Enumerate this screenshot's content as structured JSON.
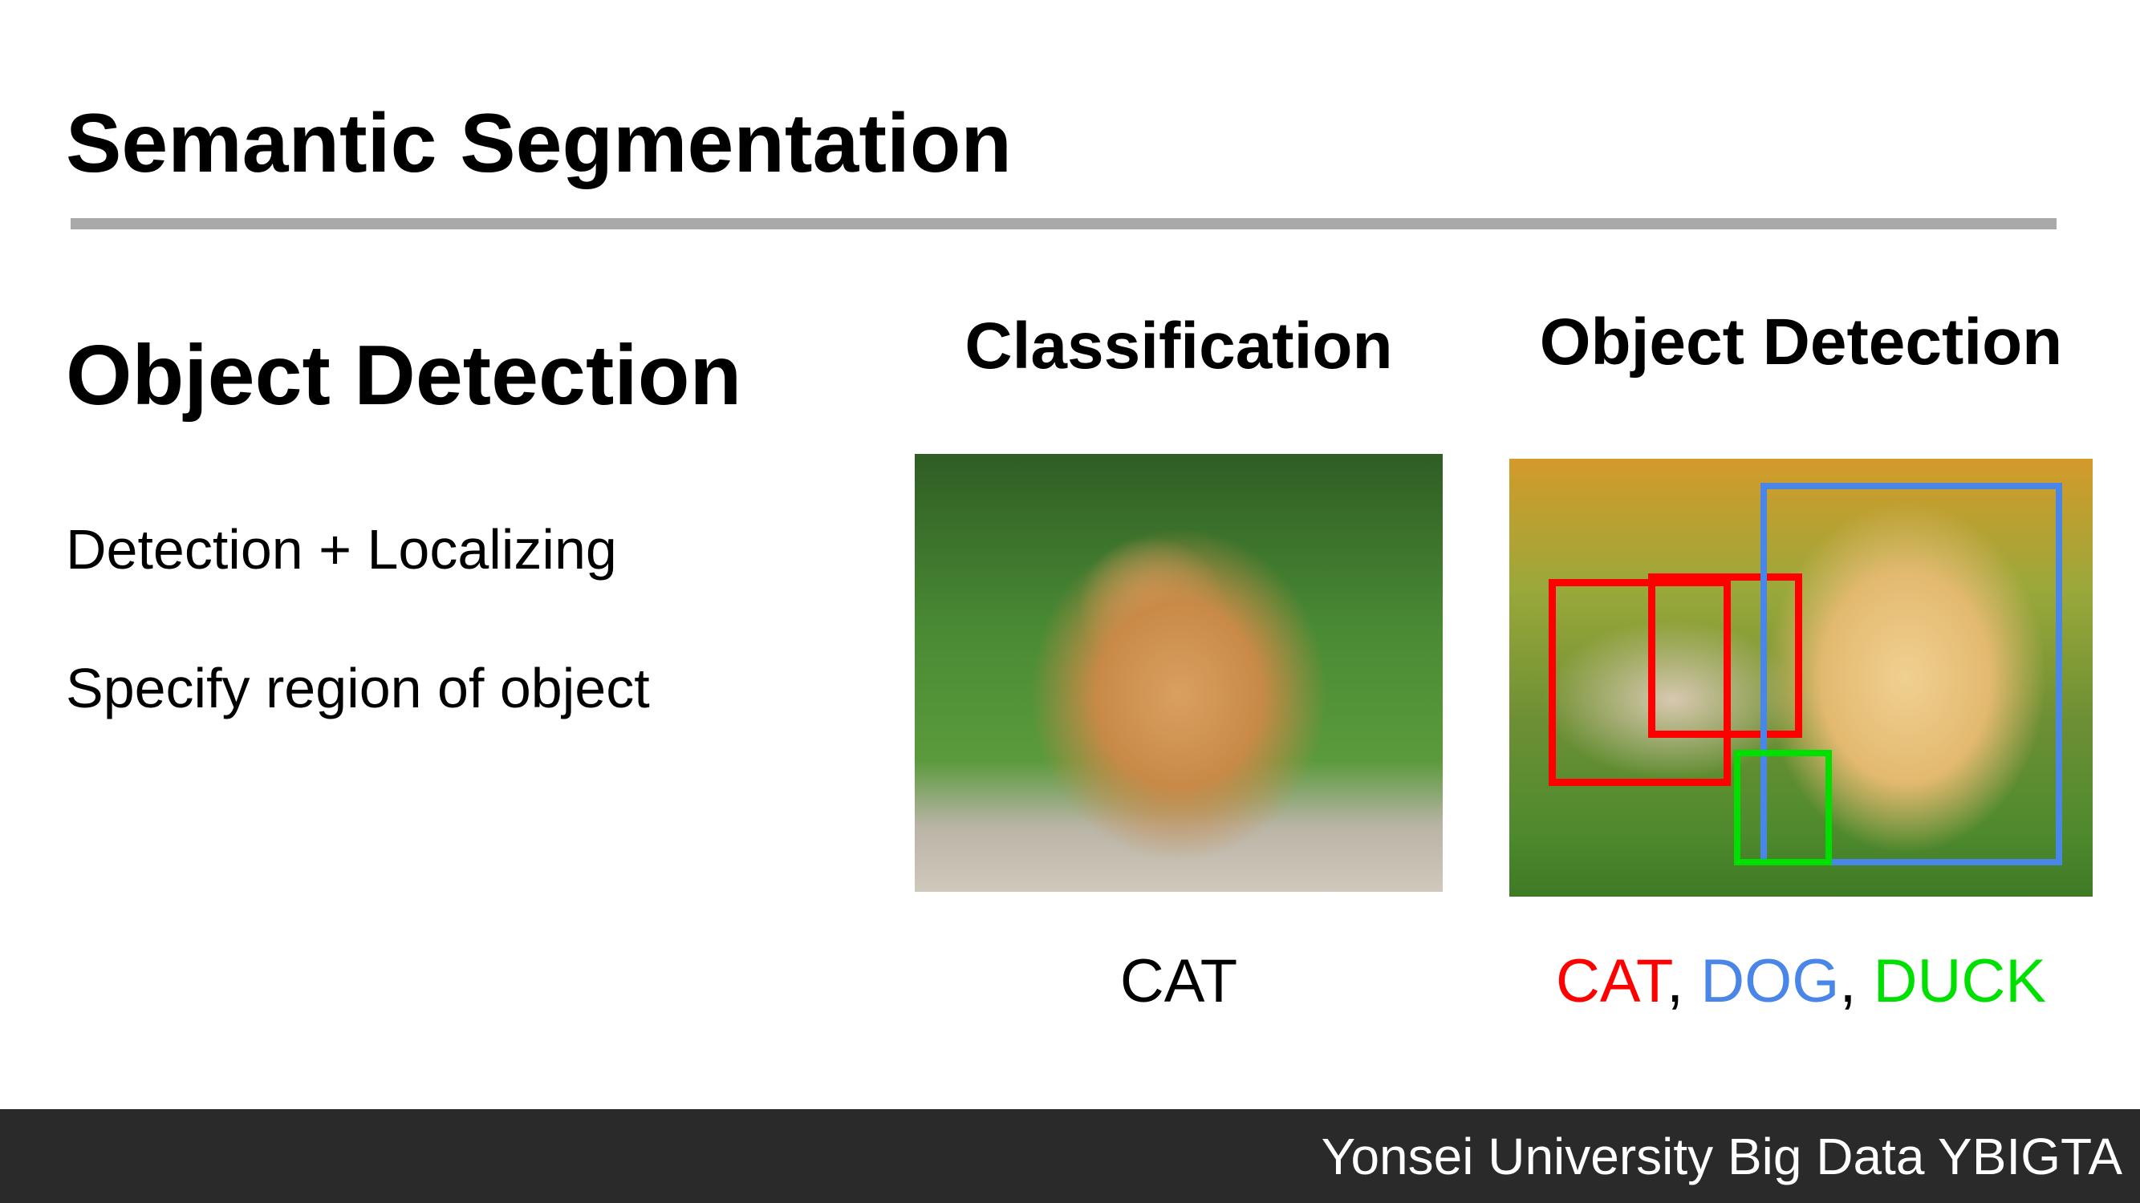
{
  "slide": {
    "title": "Semantic Segmentation",
    "subtitle": "Object Detection",
    "bullets": [
      "Detection + Localizing",
      "Specify region of object"
    ]
  },
  "figure": {
    "classification": {
      "heading": "Classification",
      "label": "CAT"
    },
    "detection": {
      "heading": "Object Detection",
      "labels": [
        {
          "text": "CAT",
          "color": "#ff0000"
        },
        {
          "text": ", ",
          "color": "#000000"
        },
        {
          "text": "DOG",
          "color": "#4a86e8"
        },
        {
          "text": ", ",
          "color": "#000000"
        },
        {
          "text": "DUCK",
          "color": "#00e000"
        }
      ],
      "box_colors": {
        "cat": "#ff0000",
        "dog": "#4a86e8",
        "duck": "#00e000"
      }
    }
  },
  "footer": {
    "text": "Yonsei University Big Data YBIGTA"
  }
}
